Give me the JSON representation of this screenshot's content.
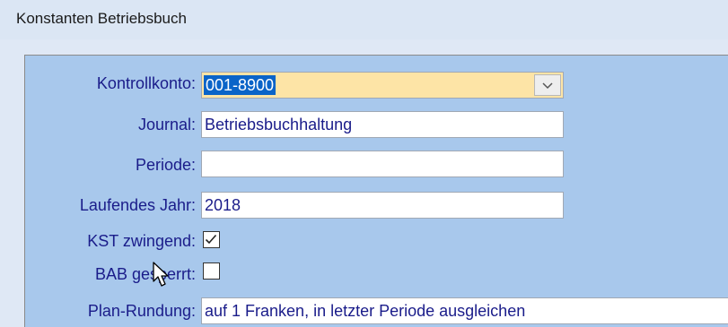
{
  "window": {
    "title": "Konstanten Betriebsbuch"
  },
  "form": {
    "kontrollkonto": {
      "label": "Kontrollkonto:",
      "value": "001-8900"
    },
    "journal": {
      "label": "Journal:",
      "value": "Betriebsbuchhaltung"
    },
    "periode": {
      "label": "Periode:",
      "value": ""
    },
    "laufendes_jahr": {
      "label": "Laufendes Jahr:",
      "value": "2018"
    },
    "kst_zwingend": {
      "label": "KST zwingend:",
      "checked": true
    },
    "bab_gesperrt": {
      "label": "BAB gesperrt:",
      "checked": false
    },
    "plan_rundung": {
      "label": "Plan-Rundung:",
      "value": "auf 1 Franken, in letzter Periode ausgleichen"
    }
  },
  "icons": {
    "dropdown": "chevron-down-icon",
    "checkmark": "checkmark-icon",
    "cursor": "mouse-pointer-icon"
  },
  "colors": {
    "panel_background": "#a8c8ec",
    "label_text": "#1a1c8a",
    "combo_background": "#fde4a6",
    "selection": "#0a64c8"
  }
}
